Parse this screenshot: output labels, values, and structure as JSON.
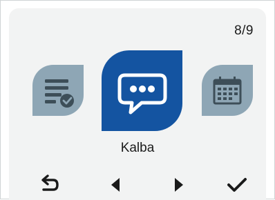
{
  "header": {
    "page_indicator": "8/9"
  },
  "carousel": {
    "current_label": "Kalba",
    "items": [
      {
        "icon": "checklist-icon"
      },
      {
        "icon": "speech-bubble-icon"
      },
      {
        "icon": "calendar-icon"
      }
    ]
  },
  "navigation": {
    "buttons": [
      {
        "icon": "back-icon"
      },
      {
        "icon": "arrow-left-icon"
      },
      {
        "icon": "arrow-right-icon"
      },
      {
        "icon": "checkmark-icon"
      }
    ]
  },
  "colors": {
    "selected_tile": "#1454a1",
    "inactive_tile": "#8ea6b5",
    "screen_background": "#f2f3f3",
    "foreground": "#1a1a1a"
  }
}
